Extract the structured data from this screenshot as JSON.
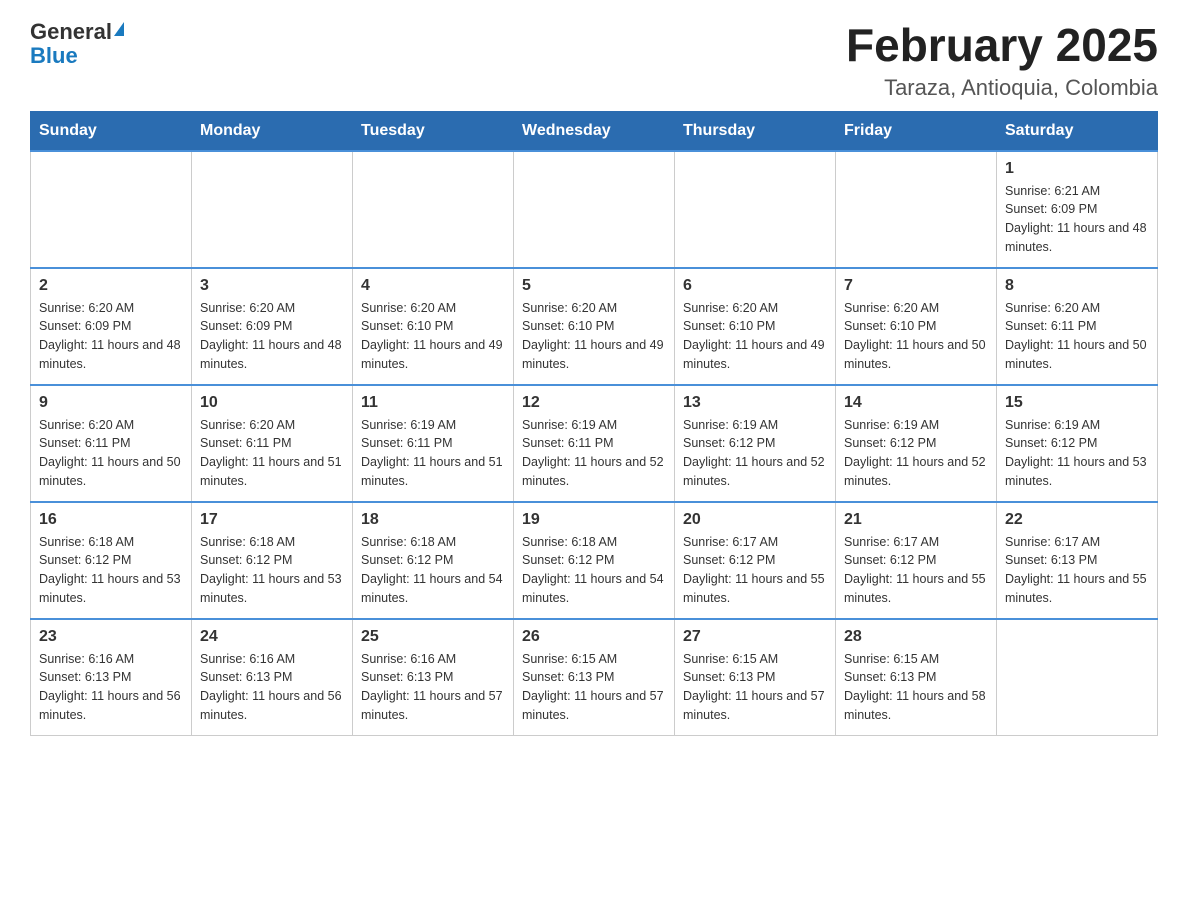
{
  "logo": {
    "general": "General",
    "blue": "Blue"
  },
  "title": "February 2025",
  "subtitle": "Taraza, Antioquia, Colombia",
  "weekdays": [
    "Sunday",
    "Monday",
    "Tuesday",
    "Wednesday",
    "Thursday",
    "Friday",
    "Saturday"
  ],
  "weeks": [
    [
      {
        "day": "",
        "info": ""
      },
      {
        "day": "",
        "info": ""
      },
      {
        "day": "",
        "info": ""
      },
      {
        "day": "",
        "info": ""
      },
      {
        "day": "",
        "info": ""
      },
      {
        "day": "",
        "info": ""
      },
      {
        "day": "1",
        "info": "Sunrise: 6:21 AM\nSunset: 6:09 PM\nDaylight: 11 hours and 48 minutes."
      }
    ],
    [
      {
        "day": "2",
        "info": "Sunrise: 6:20 AM\nSunset: 6:09 PM\nDaylight: 11 hours and 48 minutes."
      },
      {
        "day": "3",
        "info": "Sunrise: 6:20 AM\nSunset: 6:09 PM\nDaylight: 11 hours and 48 minutes."
      },
      {
        "day": "4",
        "info": "Sunrise: 6:20 AM\nSunset: 6:10 PM\nDaylight: 11 hours and 49 minutes."
      },
      {
        "day": "5",
        "info": "Sunrise: 6:20 AM\nSunset: 6:10 PM\nDaylight: 11 hours and 49 minutes."
      },
      {
        "day": "6",
        "info": "Sunrise: 6:20 AM\nSunset: 6:10 PM\nDaylight: 11 hours and 49 minutes."
      },
      {
        "day": "7",
        "info": "Sunrise: 6:20 AM\nSunset: 6:10 PM\nDaylight: 11 hours and 50 minutes."
      },
      {
        "day": "8",
        "info": "Sunrise: 6:20 AM\nSunset: 6:11 PM\nDaylight: 11 hours and 50 minutes."
      }
    ],
    [
      {
        "day": "9",
        "info": "Sunrise: 6:20 AM\nSunset: 6:11 PM\nDaylight: 11 hours and 50 minutes."
      },
      {
        "day": "10",
        "info": "Sunrise: 6:20 AM\nSunset: 6:11 PM\nDaylight: 11 hours and 51 minutes."
      },
      {
        "day": "11",
        "info": "Sunrise: 6:19 AM\nSunset: 6:11 PM\nDaylight: 11 hours and 51 minutes."
      },
      {
        "day": "12",
        "info": "Sunrise: 6:19 AM\nSunset: 6:11 PM\nDaylight: 11 hours and 52 minutes."
      },
      {
        "day": "13",
        "info": "Sunrise: 6:19 AM\nSunset: 6:12 PM\nDaylight: 11 hours and 52 minutes."
      },
      {
        "day": "14",
        "info": "Sunrise: 6:19 AM\nSunset: 6:12 PM\nDaylight: 11 hours and 52 minutes."
      },
      {
        "day": "15",
        "info": "Sunrise: 6:19 AM\nSunset: 6:12 PM\nDaylight: 11 hours and 53 minutes."
      }
    ],
    [
      {
        "day": "16",
        "info": "Sunrise: 6:18 AM\nSunset: 6:12 PM\nDaylight: 11 hours and 53 minutes."
      },
      {
        "day": "17",
        "info": "Sunrise: 6:18 AM\nSunset: 6:12 PM\nDaylight: 11 hours and 53 minutes."
      },
      {
        "day": "18",
        "info": "Sunrise: 6:18 AM\nSunset: 6:12 PM\nDaylight: 11 hours and 54 minutes."
      },
      {
        "day": "19",
        "info": "Sunrise: 6:18 AM\nSunset: 6:12 PM\nDaylight: 11 hours and 54 minutes."
      },
      {
        "day": "20",
        "info": "Sunrise: 6:17 AM\nSunset: 6:12 PM\nDaylight: 11 hours and 55 minutes."
      },
      {
        "day": "21",
        "info": "Sunrise: 6:17 AM\nSunset: 6:12 PM\nDaylight: 11 hours and 55 minutes."
      },
      {
        "day": "22",
        "info": "Sunrise: 6:17 AM\nSunset: 6:13 PM\nDaylight: 11 hours and 55 minutes."
      }
    ],
    [
      {
        "day": "23",
        "info": "Sunrise: 6:16 AM\nSunset: 6:13 PM\nDaylight: 11 hours and 56 minutes."
      },
      {
        "day": "24",
        "info": "Sunrise: 6:16 AM\nSunset: 6:13 PM\nDaylight: 11 hours and 56 minutes."
      },
      {
        "day": "25",
        "info": "Sunrise: 6:16 AM\nSunset: 6:13 PM\nDaylight: 11 hours and 57 minutes."
      },
      {
        "day": "26",
        "info": "Sunrise: 6:15 AM\nSunset: 6:13 PM\nDaylight: 11 hours and 57 minutes."
      },
      {
        "day": "27",
        "info": "Sunrise: 6:15 AM\nSunset: 6:13 PM\nDaylight: 11 hours and 57 minutes."
      },
      {
        "day": "28",
        "info": "Sunrise: 6:15 AM\nSunset: 6:13 PM\nDaylight: 11 hours and 58 minutes."
      },
      {
        "day": "",
        "info": ""
      }
    ]
  ]
}
